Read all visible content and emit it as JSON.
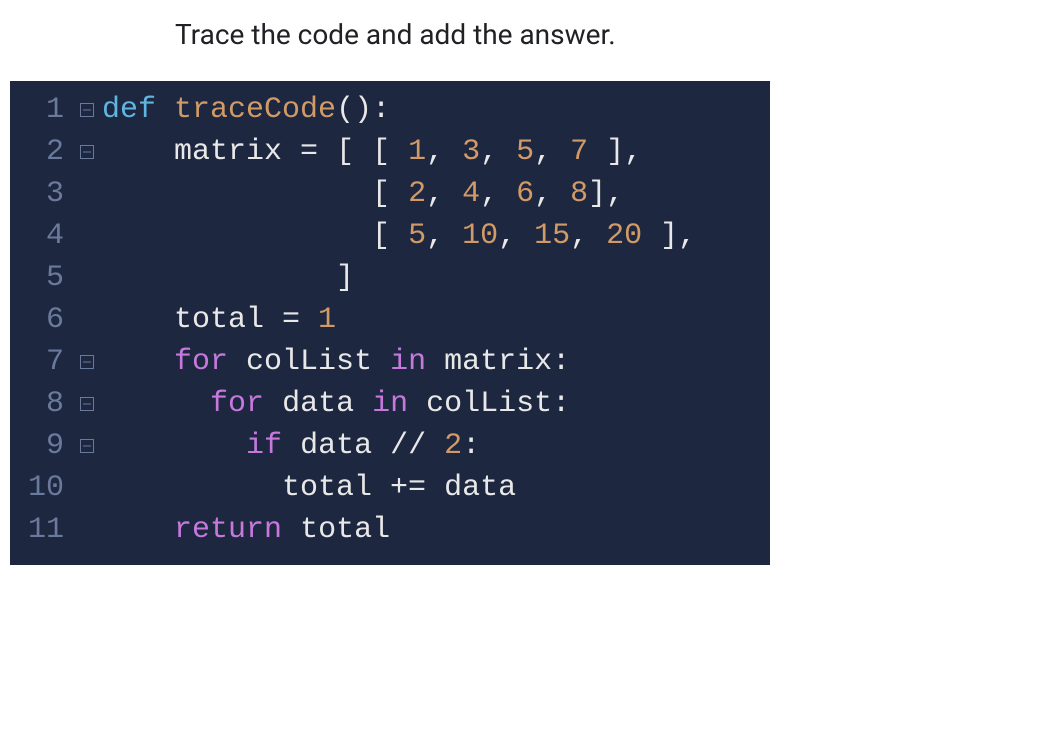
{
  "instruction": "Trace the code and add the answer.",
  "code": {
    "lines": [
      {
        "num": "1",
        "fold": true
      },
      {
        "num": "2",
        "fold": true
      },
      {
        "num": "3",
        "fold": false
      },
      {
        "num": "4",
        "fold": false
      },
      {
        "num": "5",
        "fold": false
      },
      {
        "num": "6",
        "fold": false
      },
      {
        "num": "7",
        "fold": true
      },
      {
        "num": "8",
        "fold": true
      },
      {
        "num": "9",
        "fold": true
      },
      {
        "num": "10",
        "fold": false
      },
      {
        "num": "11",
        "fold": false
      }
    ],
    "tokens": {
      "l1": {
        "def": "def",
        "name": "traceCode",
        "parens": "():"
      },
      "l2": {
        "indent": "    ",
        "var": "matrix",
        "eq": " = ",
        "open": "[ [ ",
        "n1": "1",
        "c": ", ",
        "n2": "3",
        "n3": "5",
        "n4": "7",
        "close": " ],"
      },
      "l3": {
        "indent": "               ",
        "open": "[ ",
        "n1": "2",
        "c": ", ",
        "n2": "4",
        "n3": "6",
        "n4": "8",
        "close": "],"
      },
      "l4": {
        "indent": "               ",
        "open": "[ ",
        "n1": "5",
        "c": ", ",
        "n2": "10",
        "n3": "15",
        "n4": "20",
        "close": " ],"
      },
      "l5": {
        "indent": "             ",
        "close": "]"
      },
      "l6": {
        "indent": "    ",
        "var": "total",
        "eq": " = ",
        "n": "1"
      },
      "l7": {
        "indent": "    ",
        "for": "for",
        "sp": " ",
        "v1": "colList",
        "in": " in ",
        "v2": "matrix",
        "colon": ":"
      },
      "l8": {
        "indent": "      ",
        "for": "for",
        "sp": " ",
        "v1": "data",
        "in": " in ",
        "v2": "colList",
        "colon": ":"
      },
      "l9": {
        "indent": "        ",
        "if": "if",
        "sp": " ",
        "v": "data",
        "op": " // ",
        "n": "2",
        "colon": ":"
      },
      "l10": {
        "indent": "          ",
        "v1": "total",
        "op": " += ",
        "v2": "data"
      },
      "l11": {
        "indent": "    ",
        "ret": "return",
        "sp": " ",
        "v": "total"
      }
    }
  }
}
